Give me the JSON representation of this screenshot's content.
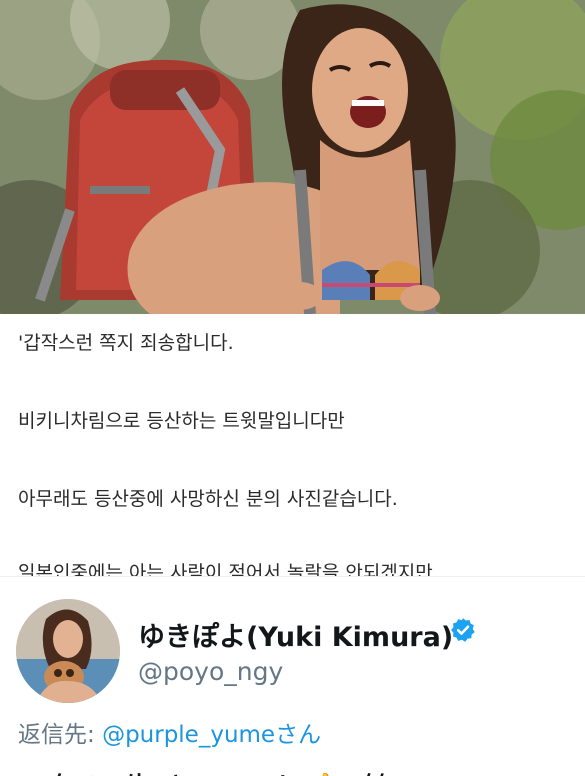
{
  "message": {
    "lines": [
      "'갑작스런 쪽지 죄송합니다.",
      "비키니차림으로 등산하는 트윗말입니다만",
      "아무래도 등산중에 사망하신 분의 사진같습니다.",
      "일본인중에는 아는 사람이 적어서 놀랄을 안되겠지만"
    ]
  },
  "tweet": {
    "display_name": "ゆきぽよ(Yuki Kimura)",
    "handle": "@poyo_ngy",
    "reply_prefix": "返信先: ",
    "reply_mention": "@purple_yumeさん",
    "body": "元気に生きてるよ👍(笑)",
    "verified_icon": "verified-badge-icon",
    "accent_color": "#1da1f2"
  },
  "photo": {
    "subject": "hiker-photo"
  }
}
